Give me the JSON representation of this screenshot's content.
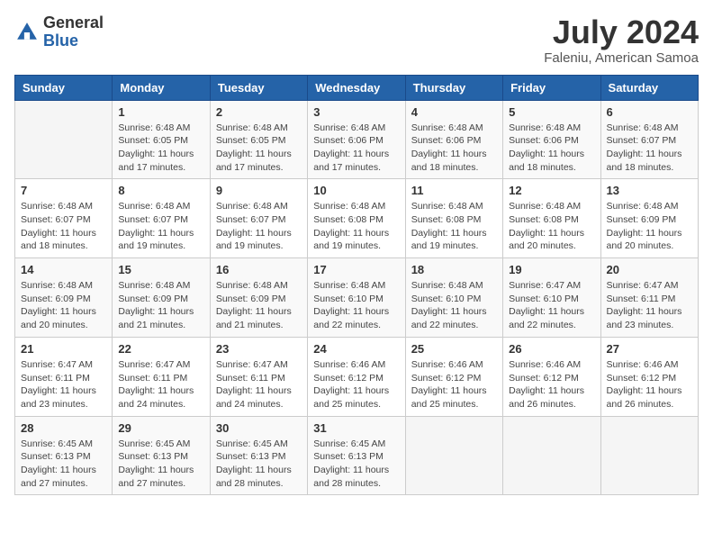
{
  "logo": {
    "general": "General",
    "blue": "Blue"
  },
  "title": {
    "month_year": "July 2024",
    "location": "Faleniu, American Samoa"
  },
  "weekdays": [
    "Sunday",
    "Monday",
    "Tuesday",
    "Wednesday",
    "Thursday",
    "Friday",
    "Saturday"
  ],
  "weeks": [
    [
      null,
      {
        "day": 1,
        "sunrise": "6:48 AM",
        "sunset": "6:05 PM",
        "daylight": "11 hours and 17 minutes."
      },
      {
        "day": 2,
        "sunrise": "6:48 AM",
        "sunset": "6:05 PM",
        "daylight": "11 hours and 17 minutes."
      },
      {
        "day": 3,
        "sunrise": "6:48 AM",
        "sunset": "6:06 PM",
        "daylight": "11 hours and 17 minutes."
      },
      {
        "day": 4,
        "sunrise": "6:48 AM",
        "sunset": "6:06 PM",
        "daylight": "11 hours and 18 minutes."
      },
      {
        "day": 5,
        "sunrise": "6:48 AM",
        "sunset": "6:06 PM",
        "daylight": "11 hours and 18 minutes."
      },
      {
        "day": 6,
        "sunrise": "6:48 AM",
        "sunset": "6:07 PM",
        "daylight": "11 hours and 18 minutes."
      }
    ],
    [
      {
        "day": 7,
        "sunrise": "6:48 AM",
        "sunset": "6:07 PM",
        "daylight": "11 hours and 18 minutes."
      },
      {
        "day": 8,
        "sunrise": "6:48 AM",
        "sunset": "6:07 PM",
        "daylight": "11 hours and 19 minutes."
      },
      {
        "day": 9,
        "sunrise": "6:48 AM",
        "sunset": "6:07 PM",
        "daylight": "11 hours and 19 minutes."
      },
      {
        "day": 10,
        "sunrise": "6:48 AM",
        "sunset": "6:08 PM",
        "daylight": "11 hours and 19 minutes."
      },
      {
        "day": 11,
        "sunrise": "6:48 AM",
        "sunset": "6:08 PM",
        "daylight": "11 hours and 19 minutes."
      },
      {
        "day": 12,
        "sunrise": "6:48 AM",
        "sunset": "6:08 PM",
        "daylight": "11 hours and 20 minutes."
      },
      {
        "day": 13,
        "sunrise": "6:48 AM",
        "sunset": "6:09 PM",
        "daylight": "11 hours and 20 minutes."
      }
    ],
    [
      {
        "day": 14,
        "sunrise": "6:48 AM",
        "sunset": "6:09 PM",
        "daylight": "11 hours and 20 minutes."
      },
      {
        "day": 15,
        "sunrise": "6:48 AM",
        "sunset": "6:09 PM",
        "daylight": "11 hours and 21 minutes."
      },
      {
        "day": 16,
        "sunrise": "6:48 AM",
        "sunset": "6:09 PM",
        "daylight": "11 hours and 21 minutes."
      },
      {
        "day": 17,
        "sunrise": "6:48 AM",
        "sunset": "6:10 PM",
        "daylight": "11 hours and 22 minutes."
      },
      {
        "day": 18,
        "sunrise": "6:48 AM",
        "sunset": "6:10 PM",
        "daylight": "11 hours and 22 minutes."
      },
      {
        "day": 19,
        "sunrise": "6:47 AM",
        "sunset": "6:10 PM",
        "daylight": "11 hours and 22 minutes."
      },
      {
        "day": 20,
        "sunrise": "6:47 AM",
        "sunset": "6:11 PM",
        "daylight": "11 hours and 23 minutes."
      }
    ],
    [
      {
        "day": 21,
        "sunrise": "6:47 AM",
        "sunset": "6:11 PM",
        "daylight": "11 hours and 23 minutes."
      },
      {
        "day": 22,
        "sunrise": "6:47 AM",
        "sunset": "6:11 PM",
        "daylight": "11 hours and 24 minutes."
      },
      {
        "day": 23,
        "sunrise": "6:47 AM",
        "sunset": "6:11 PM",
        "daylight": "11 hours and 24 minutes."
      },
      {
        "day": 24,
        "sunrise": "6:46 AM",
        "sunset": "6:12 PM",
        "daylight": "11 hours and 25 minutes."
      },
      {
        "day": 25,
        "sunrise": "6:46 AM",
        "sunset": "6:12 PM",
        "daylight": "11 hours and 25 minutes."
      },
      {
        "day": 26,
        "sunrise": "6:46 AM",
        "sunset": "6:12 PM",
        "daylight": "11 hours and 26 minutes."
      },
      {
        "day": 27,
        "sunrise": "6:46 AM",
        "sunset": "6:12 PM",
        "daylight": "11 hours and 26 minutes."
      }
    ],
    [
      {
        "day": 28,
        "sunrise": "6:45 AM",
        "sunset": "6:13 PM",
        "daylight": "11 hours and 27 minutes."
      },
      {
        "day": 29,
        "sunrise": "6:45 AM",
        "sunset": "6:13 PM",
        "daylight": "11 hours and 27 minutes."
      },
      {
        "day": 30,
        "sunrise": "6:45 AM",
        "sunset": "6:13 PM",
        "daylight": "11 hours and 28 minutes."
      },
      {
        "day": 31,
        "sunrise": "6:45 AM",
        "sunset": "6:13 PM",
        "daylight": "11 hours and 28 minutes."
      },
      null,
      null,
      null
    ]
  ]
}
